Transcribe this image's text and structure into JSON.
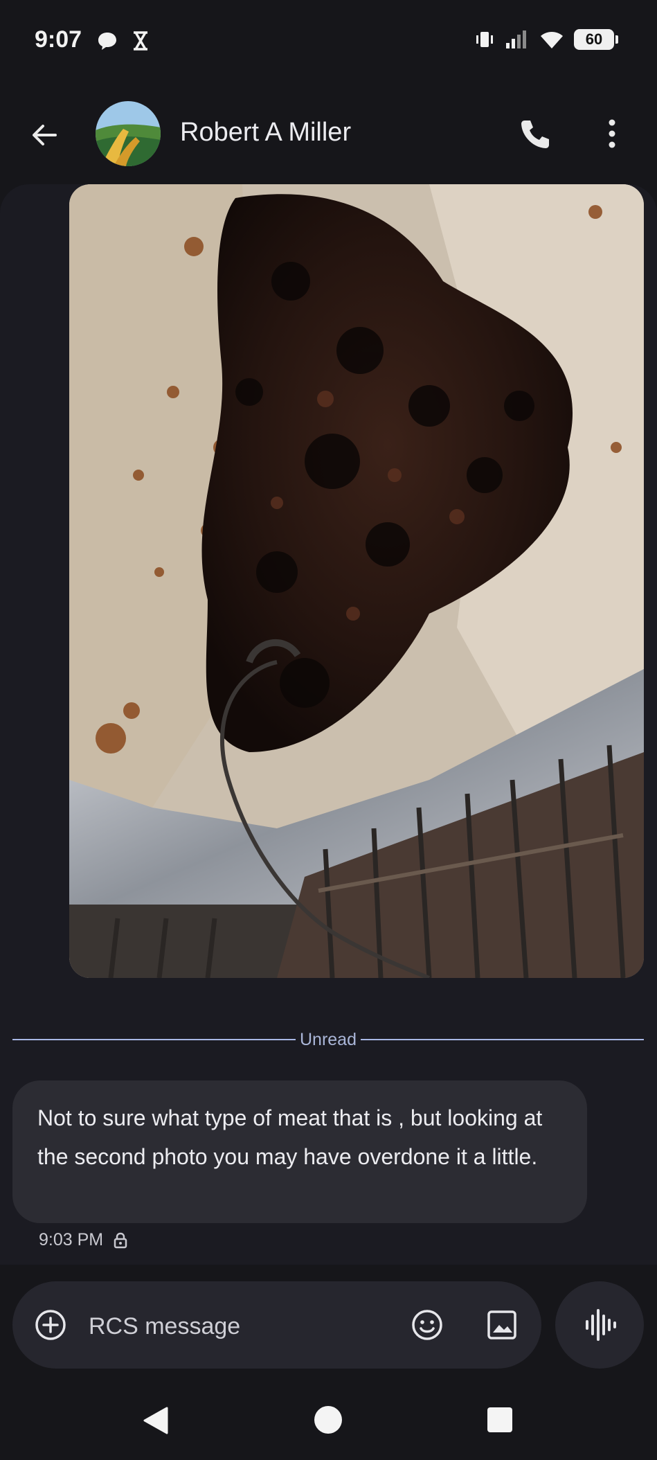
{
  "status_bar": {
    "time": "9:07",
    "battery": "60",
    "left_icons": [
      "chat-bubble-icon",
      "hourglass-icon"
    ],
    "right_icons": [
      "vibrate-icon",
      "signal-icon",
      "wifi-icon",
      "battery-icon"
    ]
  },
  "header": {
    "contact_name": "Robert A Miller",
    "icons": [
      "back-arrow-icon",
      "phone-icon",
      "more-vert-icon"
    ]
  },
  "conversation": {
    "image_description_icon": "photo-of-smoked-meat",
    "unread_label": "Unread",
    "messages": [
      {
        "text": "Not to sure what type of meat that is , but looking at the second photo you may have overdone it a little.",
        "time": "9:03 PM",
        "status_icon": "lock-icon"
      }
    ]
  },
  "composer": {
    "placeholder": "RCS message",
    "icons": [
      "add-circle-icon",
      "emoji-icon",
      "gallery-icon",
      "voice-icon"
    ]
  },
  "colors": {
    "background": "#16161a",
    "bubble": "#2c2c33",
    "divider": "#a9b8e6"
  }
}
